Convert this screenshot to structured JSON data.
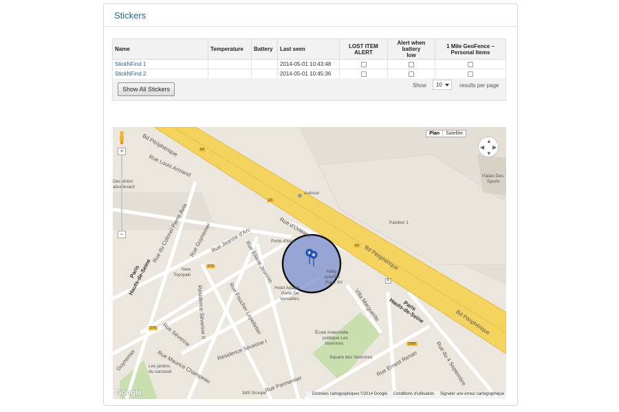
{
  "panel": {
    "title": "Stickers"
  },
  "table": {
    "headers": {
      "name": "Name",
      "temperature": "Temperature",
      "battery": "Battery",
      "last_seen": "Last seen",
      "lost_alert": "LOST ITEM ALERT",
      "battery_alert_1": "Alert when battery",
      "battery_alert_2": "low",
      "geofence_1": "1 Mile GeoFence –",
      "geofence_2": "Personal Items"
    },
    "rows": [
      {
        "name": "StickNFind 1",
        "temperature": "",
        "battery": "",
        "last_seen": "2014-05-01 10:43:48",
        "lost_alert": false,
        "battery_alert": false,
        "geofence": false
      },
      {
        "name": "StickNFind 2",
        "temperature": "",
        "battery": "",
        "last_seen": "2014-05-01 10:45:36",
        "lost_alert": false,
        "battery_alert": false,
        "geofence": false
      }
    ]
  },
  "toolbar": {
    "show_all_label": "Show All Stickers",
    "show_label": "Show",
    "page_size": "10",
    "results_per_page": "results per page"
  },
  "map": {
    "type_plan": "Plan",
    "type_satellite": "Satellite",
    "zoom_in": "+",
    "zoom_out": "−",
    "labels": {
      "bd_peripherique_top": "Bd Périphérique",
      "bd_peripherique_right": "Bd Périphérique",
      "rue_louis_armand": "Rue Louis Armand",
      "autosur": "Autosur",
      "pavillon1": "Pavillon 1",
      "palais_des_sports_1": "Palais Des",
      "palais_des_sports_2": "Sports",
      "decathlon_1": "Decathlon",
      "decathlon_2": "aboi levard",
      "rue_colonel_pierre_avia": "Rue du Colonel Pierre Avia",
      "rue_guynemer": "Rue Guynemer",
      "rue_jeanne_arc": "Rue Jeanne d'Arc",
      "rue_orleans": "Rue d'Orléans",
      "porte_d_issy": "Porte d'Issy",
      "new_toyoyaki_1": "New",
      "new_toyoyaki_2": "Toyoyaki",
      "rue_eliane_jeannin": "Rue Eliane Jeannin",
      "hotel_adagio_1": "Hotel Adagio",
      "hotel_adagio_2": "Porte De",
      "hotel_adagio_3": "Versailles",
      "adagio_apart_1": "Adag",
      "adagio_apart_2": "Apartho",
      "adagio_apart_3": "Paris XV",
      "rue_foucher_lepelletier": "Rue Foucher Lepelletier",
      "residence_severine_ii": "Résidence Séverine II",
      "residence_severine_i": "Résidence Séverine I",
      "rue_severine": "Rue Séverine",
      "villa_marguerite": "Villa Marguerite",
      "paris_hds_left_1": "Paris",
      "paris_hds_left_2": "Hauts-de-Seine",
      "paris_hds_right_1": "Paris",
      "paris_hds_right_2": "Hauts-de-Seine",
      "ecole_1": "École maternelle",
      "ecole_2": "publique Les",
      "ecole_3": "Varennes",
      "square_varennes": "Square des Varennes",
      "rue_ernest_renan": "Rue Ernest Renan",
      "rue_4_septembre": "Rue du 4 Septembre",
      "rue_maurice_champeau": "Rue Maurice Champeau",
      "jardins_1": "Les jardins",
      "jardins_2": "du carousel",
      "rue_guynemer_low": "Guynemer",
      "rue_parmentier": "Rue Parmentier",
      "groupe_3ds": "3dS Groupe"
    },
    "shields": {
      "e5a": "E5",
      "e5b": "E5",
      "e5c": "E5",
      "d76": "D76",
      "d76b": "D76",
      "d989": "D989",
      "p": "P"
    },
    "google": "Google",
    "attribution": {
      "data": "Données cartographiques ©2014 Google",
      "terms": "Conditions d'utilisation",
      "report": "Signaler une erreur cartographique"
    },
    "colors": {
      "highway": "#f4d35e",
      "geofence_fill": "#7b8fd0",
      "geofence_stroke": "#111111",
      "park": "#c9dfb0",
      "block": "#e2ddd3"
    }
  }
}
